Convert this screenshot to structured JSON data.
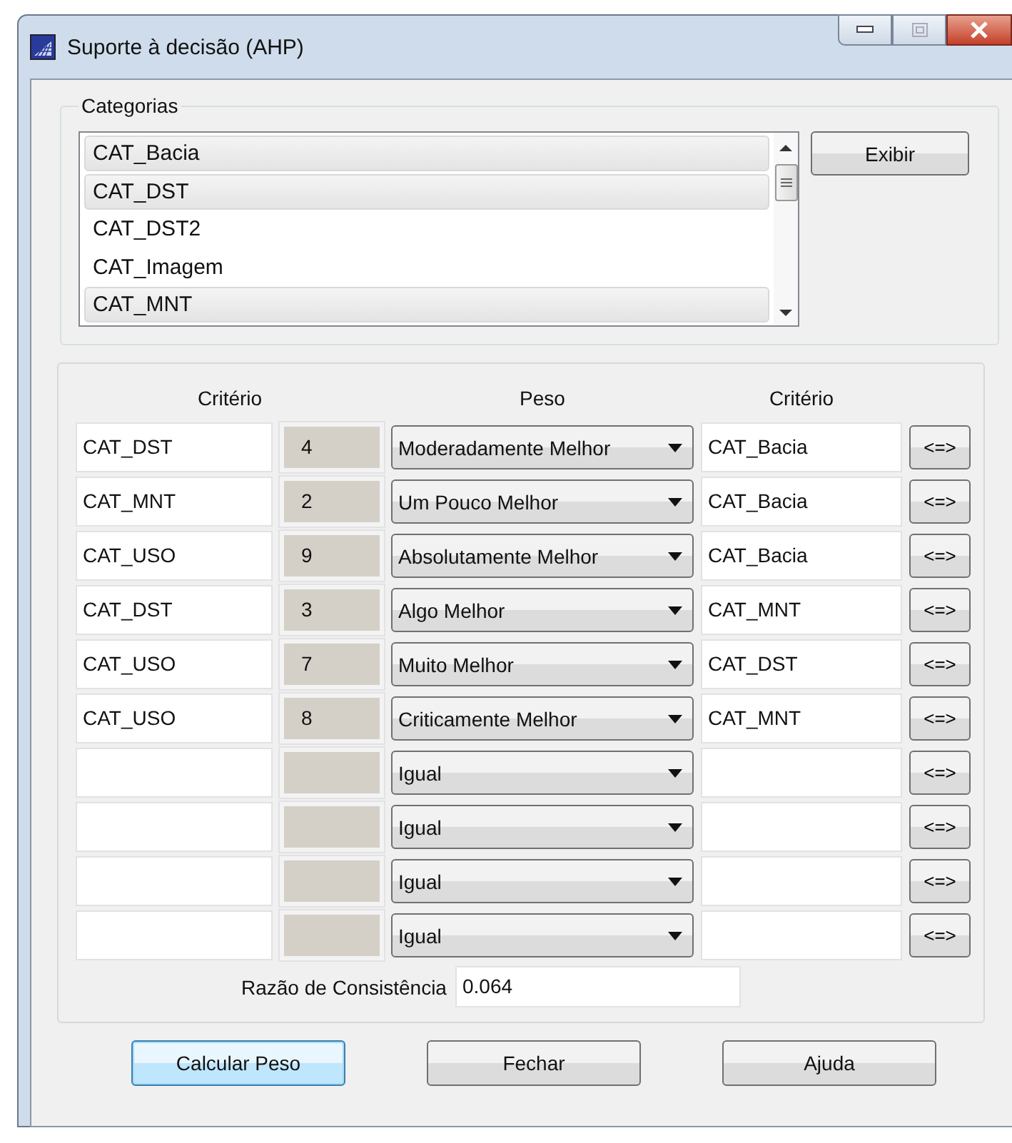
{
  "window": {
    "title": "Suporte à decisão (AHP)"
  },
  "categories": {
    "label": "Categorias",
    "items": [
      {
        "label": "CAT_Bacia",
        "selected": true
      },
      {
        "label": "CAT_DST",
        "selected": true
      },
      {
        "label": "CAT_DST2",
        "selected": false
      },
      {
        "label": "CAT_Imagem",
        "selected": false
      },
      {
        "label": "CAT_MNT",
        "selected": true
      }
    ],
    "button": "Exibir"
  },
  "comparison": {
    "headers": [
      "Critério",
      "Peso",
      "Critério"
    ],
    "swap_label": "<=>",
    "rows": [
      {
        "left": "CAT_DST",
        "weight": "4",
        "choice": "Moderadamente Melhor",
        "right": "CAT_Bacia"
      },
      {
        "left": "CAT_MNT",
        "weight": "2",
        "choice": "Um Pouco Melhor",
        "right": "CAT_Bacia"
      },
      {
        "left": "CAT_USO",
        "weight": "9",
        "choice": "Absolutamente Melhor",
        "right": "CAT_Bacia"
      },
      {
        "left": "CAT_DST",
        "weight": "3",
        "choice": "Algo Melhor",
        "right": "CAT_MNT"
      },
      {
        "left": "CAT_USO",
        "weight": "7",
        "choice": "Muito Melhor",
        "right": "CAT_DST"
      },
      {
        "left": "CAT_USO",
        "weight": "8",
        "choice": "Criticamente Melhor",
        "right": "CAT_MNT"
      },
      {
        "choice": "Igual"
      },
      {
        "choice": "Igual"
      },
      {
        "choice": "Igual"
      },
      {
        "choice": "Igual"
      }
    ],
    "consistency_label": "Razão de Consistência",
    "consistency_value": "0.064"
  },
  "buttons": [
    {
      "label": "Calcular Peso",
      "focused": true
    },
    {
      "label": "Fechar",
      "focused": false
    },
    {
      "label": "Ajuda",
      "focused": false
    }
  ]
}
